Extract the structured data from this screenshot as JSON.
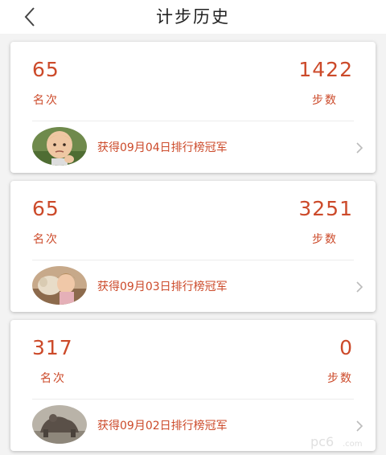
{
  "header": {
    "title": "计步历史",
    "back_icon": "chevron-left-icon"
  },
  "colors": {
    "accent": "#cc4a2a",
    "background": "#f3f3f3",
    "card": "#ffffff"
  },
  "records": [
    {
      "rank": "65",
      "rank_label": "名次",
      "steps": "1422",
      "steps_label": "步数",
      "champion_text": "获得09月04日排行榜冠军",
      "avatar_icon": "baby-avatar"
    },
    {
      "rank": "65",
      "rank_label": "名次",
      "steps": "3251",
      "steps_label": "步数",
      "champion_text": "获得09月03日排行榜冠军",
      "avatar_icon": "child-with-animal-avatar"
    },
    {
      "rank": "317",
      "rank_label": "名次",
      "steps": "0",
      "steps_label": "步数",
      "champion_text": "获得09月02日排行榜冠军",
      "avatar_icon": "statue-avatar"
    }
  ],
  "watermark": {
    "text": "pc6",
    "sub": ".com"
  }
}
